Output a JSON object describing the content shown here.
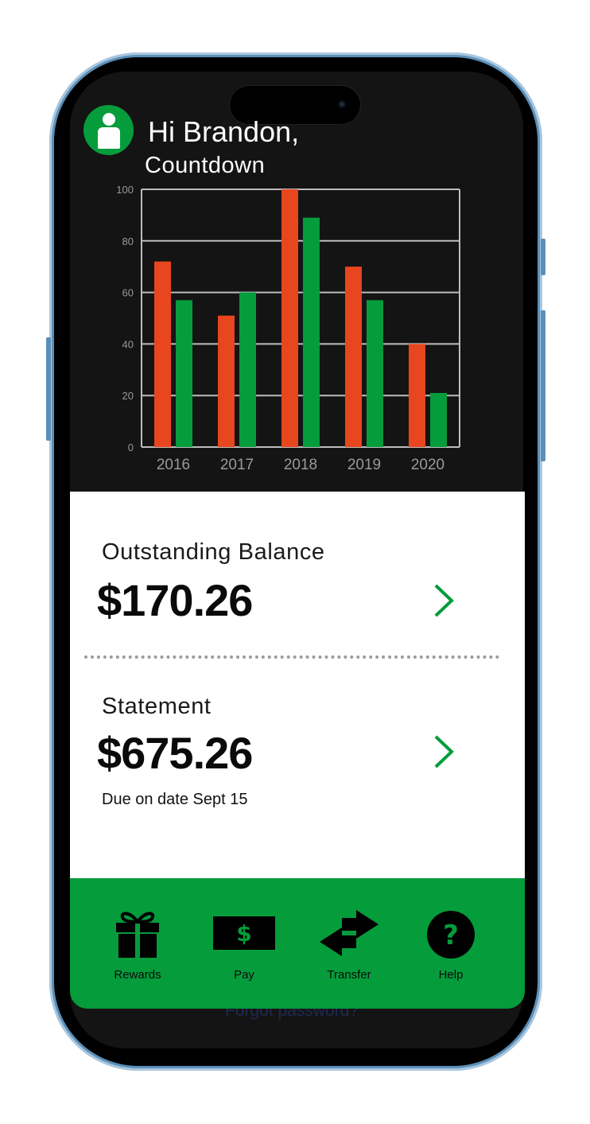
{
  "header": {
    "greeting": "Hi Brandon,",
    "subtitle": "Countdown"
  },
  "colors": {
    "accent_green": "#059c3c",
    "accent_red": "#e8461f",
    "screen_bg": "#141414"
  },
  "chart_data": {
    "type": "bar",
    "categories": [
      "2016",
      "2017",
      "2018",
      "2019",
      "2020"
    ],
    "series": [
      {
        "values": [
          72,
          51,
          100,
          70,
          40
        ],
        "color": "#e8461f"
      },
      {
        "values": [
          57,
          60,
          89,
          57,
          21
        ],
        "color": "#059c3c"
      }
    ],
    "yticks": [
      "0",
      "20",
      "40",
      "60",
      "80",
      "100"
    ],
    "ylim": [
      0,
      100
    ],
    "grid": true
  },
  "balance": {
    "label": "Outstanding Balance",
    "amount": "$170.26"
  },
  "statement": {
    "label": "Statement",
    "amount": "$675.26",
    "due": "Due on date Sept 15"
  },
  "footer": {
    "forgot": "Forgot password?"
  },
  "nav": {
    "items": [
      {
        "label": "Rewards",
        "icon": "gift-icon"
      },
      {
        "label": "Pay",
        "icon": "dollar-bill-icon"
      },
      {
        "label": "Transfer",
        "icon": "transfer-arrows-icon"
      },
      {
        "label": "Help",
        "icon": "help-icon"
      }
    ],
    "pay_symbol": "$",
    "help_symbol": "?"
  }
}
